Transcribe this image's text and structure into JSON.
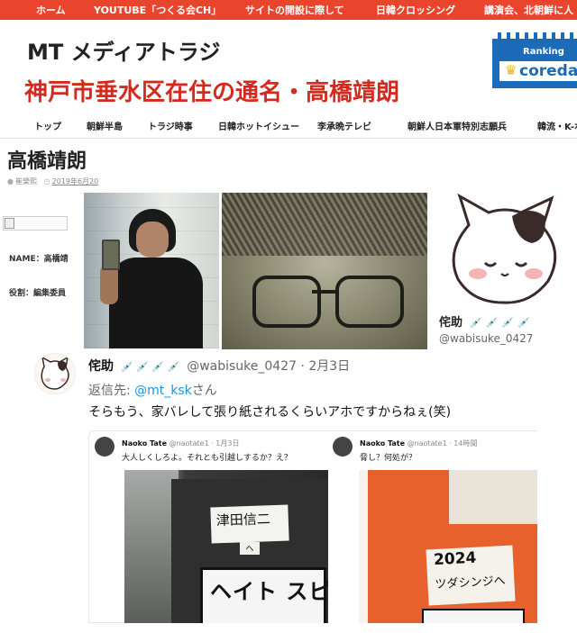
{
  "top_nav": {
    "items": [
      "ホーム",
      "YOUTUBE「つくる会CH」",
      "サイトの開設に際して",
      "日韓クロッシング",
      "講演会、北朝鮮に人"
    ]
  },
  "header": {
    "site_title": "MT メディアトラジ",
    "subtitle": "神戸市垂水区在住の通名・高橋靖朗"
  },
  "ranking_badge": {
    "label": "Ranking",
    "brand": "coreda",
    "color": "#1d6bb8"
  },
  "main_menu": {
    "items": [
      "トップ",
      "朝鮮半島",
      "トラジ時事",
      "日韓ホットイシュー",
      "李承晩テレビ",
      "朝鮮人日本軍特別志願兵",
      "韓流・K-ポ"
    ]
  },
  "post": {
    "title": "高橋靖朗",
    "author": "崔榮熙",
    "date": "2019年6月20"
  },
  "profile": {
    "name_label": "NAME：高橋靖",
    "role_label": "役割：編集委員"
  },
  "twitter_profile": {
    "name": "侘助",
    "handle": "@wabisuke_0427"
  },
  "tweet": {
    "name": "侘助",
    "handle_date": "@wabisuke_0427 · 2月3日",
    "reply_prefix": "返信先:",
    "reply_mention": "@mt_ksk",
    "reply_suffix": "さん",
    "text": "そらもう、家バレして張り紙されるくらいアホですからねぇ(笑)"
  },
  "embed_left": {
    "name": "Naoko Tate",
    "sub": "@naotate1 · 1月3日",
    "text": "大人しくしろよ。それとも引越しするか？え？"
  },
  "embed_right": {
    "name": "Naoko Tate",
    "sub": "@naotate1 · 14時間",
    "text": "脅し？何処が？"
  },
  "photo_left": {
    "sticker_name": "津田信二",
    "sticker_small": "へ",
    "sticker_bottom": "ヘイト スピーチ"
  },
  "photo_right": {
    "year": "2024",
    "name": "ツダシンジへ"
  },
  "colors": {
    "nav_red": "#e8452c",
    "subtitle_red": "#d42a1e",
    "link_blue": "#1b95e0"
  }
}
